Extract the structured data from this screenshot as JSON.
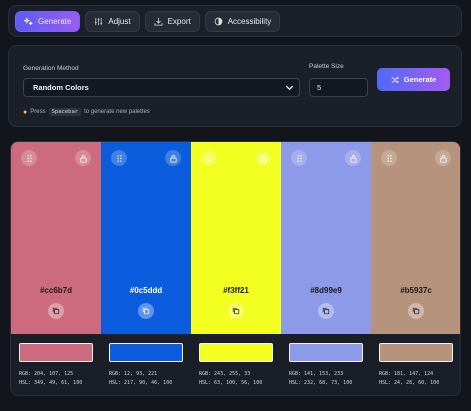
{
  "tabs": [
    {
      "label": "Generate",
      "icon": "sparkles-icon",
      "active": true
    },
    {
      "label": "Adjust",
      "icon": "sliders-icon",
      "active": false
    },
    {
      "label": "Export",
      "icon": "download-icon",
      "active": false
    },
    {
      "label": "Accessibility",
      "icon": "contrast-icon",
      "active": false
    }
  ],
  "controls": {
    "method_label": "Generation Method",
    "method_value": "Random Colors",
    "size_label": "Palette Size",
    "size_value": "5",
    "generate_label": "Generate",
    "hint_pre": "Press",
    "hint_key": "Spacebar",
    "hint_post": "to generate new palettes"
  },
  "colors": [
    {
      "hex": "#cc6b7d",
      "rgb": "RGB: 204, 107, 125",
      "hsl": "HSL: 349, 49, 61, 100",
      "bg": "#cc6b7d",
      "text": "#1a1a1a"
    },
    {
      "hex": "#0c5ddd",
      "rgb": "RGB: 12, 93, 221",
      "hsl": "HSL: 217, 90, 46, 100",
      "bg": "#0c5ddd",
      "text": "#ffffff"
    },
    {
      "hex": "#f3ff21",
      "rgb": "RGB: 243, 255, 33",
      "hsl": "HSL: 63, 100, 56, 100",
      "bg": "#f3ff21",
      "text": "#1a1a1a"
    },
    {
      "hex": "#8d99e9",
      "rgb": "RGB: 141, 153, 233",
      "hsl": "HSL: 232, 68, 73, 100",
      "bg": "#8d99e9",
      "text": "#1a1a1a"
    },
    {
      "hex": "#b5937c",
      "rgb": "RGB: 181, 147, 124",
      "hsl": "HSL: 24, 28, 60, 100",
      "bg": "#b5937c",
      "text": "#1a1a1a"
    }
  ]
}
